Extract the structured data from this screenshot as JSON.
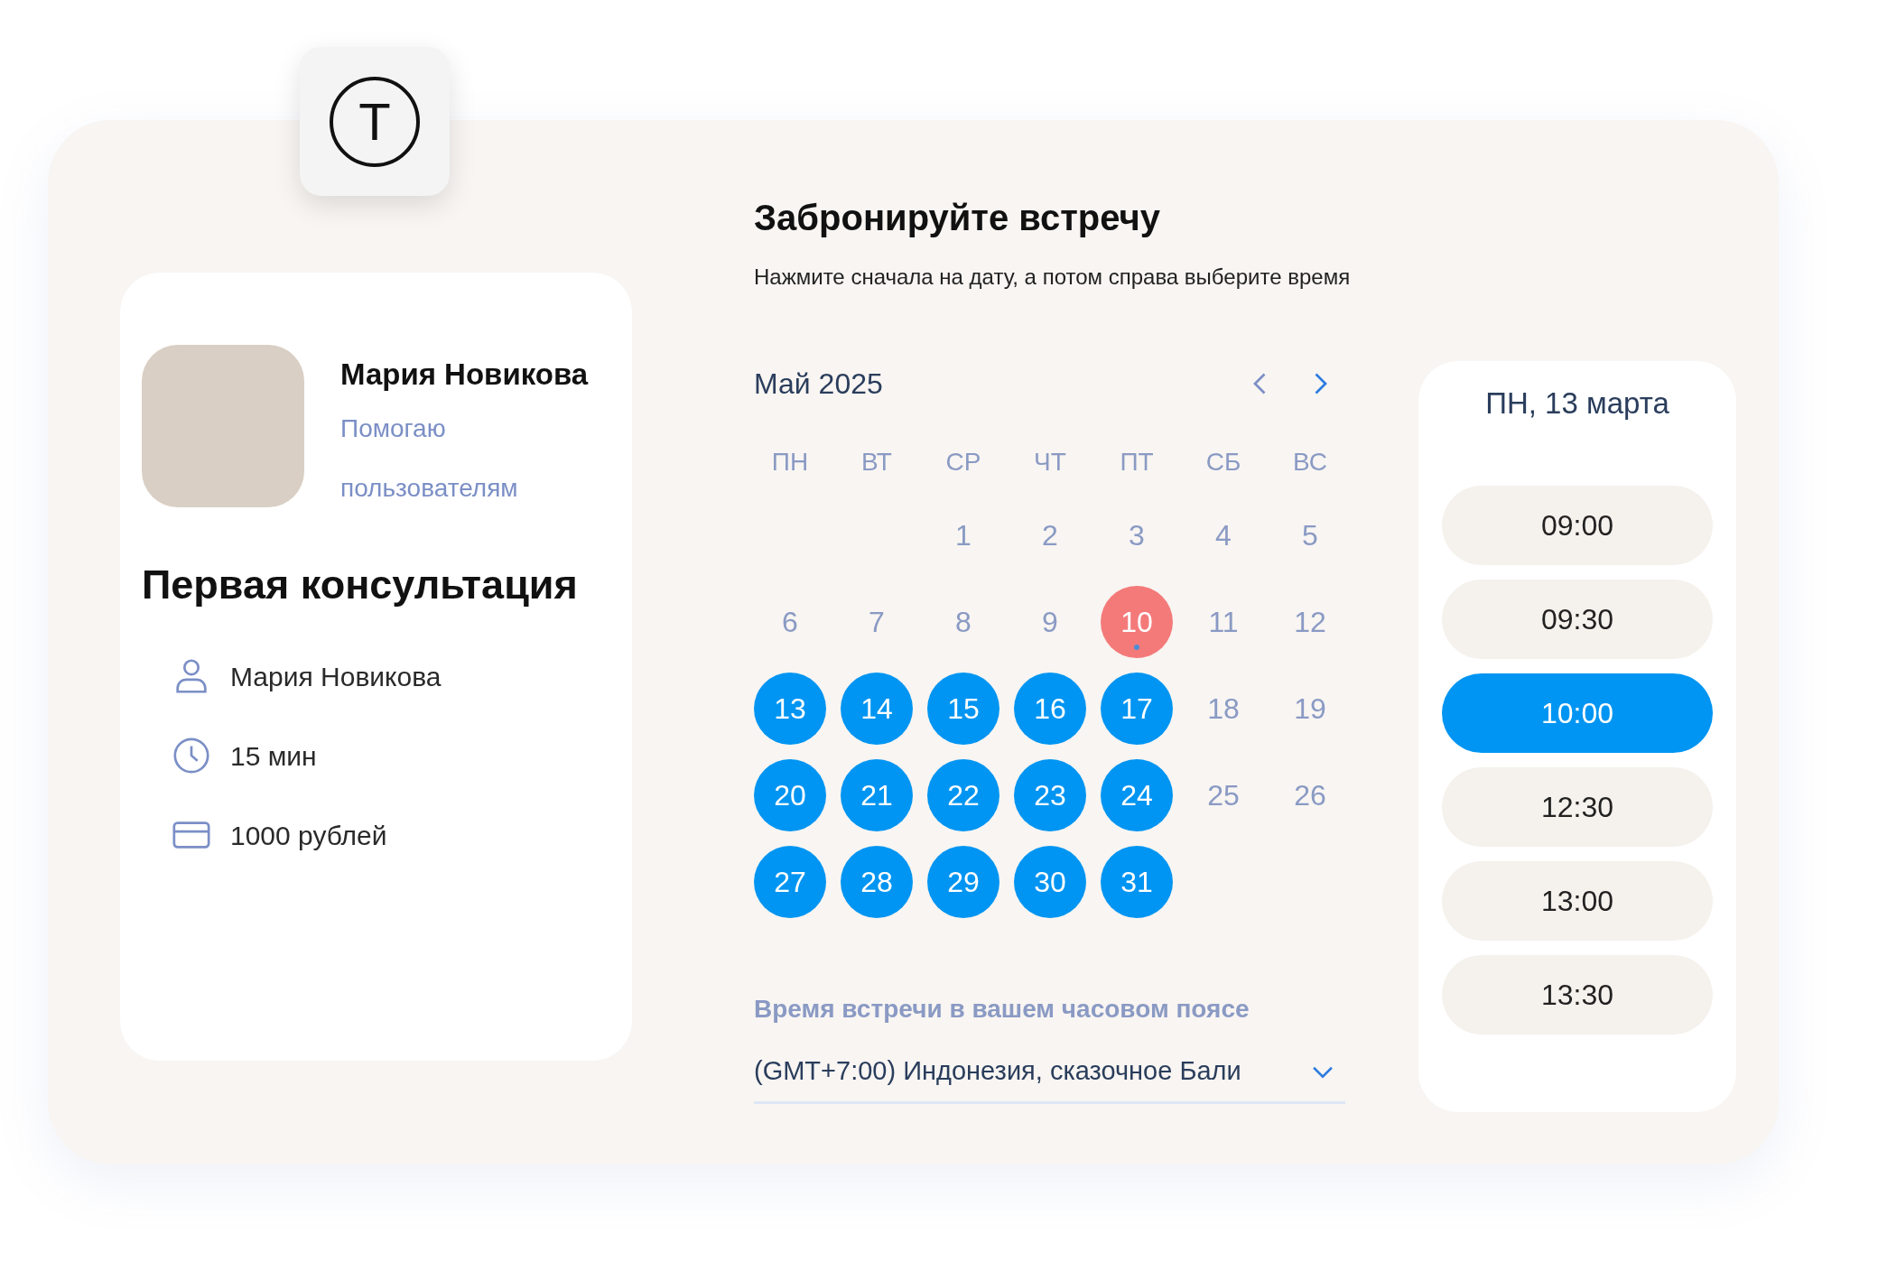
{
  "logo": {
    "letter": "Т"
  },
  "profile": {
    "name": "Мария Новикова",
    "role": "Помогаю пользователям"
  },
  "service": {
    "title": "Первая консультация",
    "details": [
      {
        "kind": "person",
        "text": "Мария Новикова"
      },
      {
        "kind": "duration",
        "text": "15 мин"
      },
      {
        "kind": "price",
        "text": "1000 рублей"
      }
    ]
  },
  "booking": {
    "title": "Забронируйте встречу",
    "subtitle": "Нажмите сначала на дату, а потом справа выберите время"
  },
  "calendar": {
    "month": "Май 2025",
    "weekdays": [
      "ПН",
      "ВТ",
      "СР",
      "ЧТ",
      "ПТ",
      "СБ",
      "ВС"
    ],
    "days": [
      {
        "label": "1",
        "kind": "plain"
      },
      {
        "label": "2",
        "kind": "plain"
      },
      {
        "label": "3",
        "kind": "plain"
      },
      {
        "label": "4",
        "kind": "plain"
      },
      {
        "label": "5",
        "kind": "plain"
      },
      {
        "label": "6",
        "kind": "plain"
      },
      {
        "label": "7",
        "kind": "plain"
      },
      {
        "label": "8",
        "kind": "plain"
      },
      {
        "label": "9",
        "kind": "plain"
      },
      {
        "label": "10",
        "kind": "today"
      },
      {
        "label": "11",
        "kind": "plain"
      },
      {
        "label": "12",
        "kind": "plain"
      },
      {
        "label": "13",
        "kind": "available"
      },
      {
        "label": "14",
        "kind": "available"
      },
      {
        "label": "15",
        "kind": "available"
      },
      {
        "label": "16",
        "kind": "available"
      },
      {
        "label": "17",
        "kind": "available"
      },
      {
        "label": "18",
        "kind": "plain"
      },
      {
        "label": "19",
        "kind": "plain"
      },
      {
        "label": "20",
        "kind": "available"
      },
      {
        "label": "21",
        "kind": "available"
      },
      {
        "label": "22",
        "kind": "available"
      },
      {
        "label": "23",
        "kind": "available"
      },
      {
        "label": "24",
        "kind": "available"
      },
      {
        "label": "25",
        "kind": "plain"
      },
      {
        "label": "26",
        "kind": "plain"
      },
      {
        "label": "27",
        "kind": "available"
      },
      {
        "label": "28",
        "kind": "available"
      },
      {
        "label": "29",
        "kind": "available"
      },
      {
        "label": "30",
        "kind": "available"
      },
      {
        "label": "31",
        "kind": "available"
      }
    ]
  },
  "timezone": {
    "label": "Время встречи в вашем часовом поясе",
    "value": "(GMT+7:00) Индонезия, сказочное Бали"
  },
  "times": {
    "date": "ПН, 13 марта",
    "slots": [
      {
        "label": "09:00",
        "selected": false
      },
      {
        "label": "09:30",
        "selected": false
      },
      {
        "label": "10:00",
        "selected": true
      },
      {
        "label": "12:30",
        "selected": false
      },
      {
        "label": "13:00",
        "selected": false
      },
      {
        "label": "13:30",
        "selected": false
      }
    ]
  }
}
